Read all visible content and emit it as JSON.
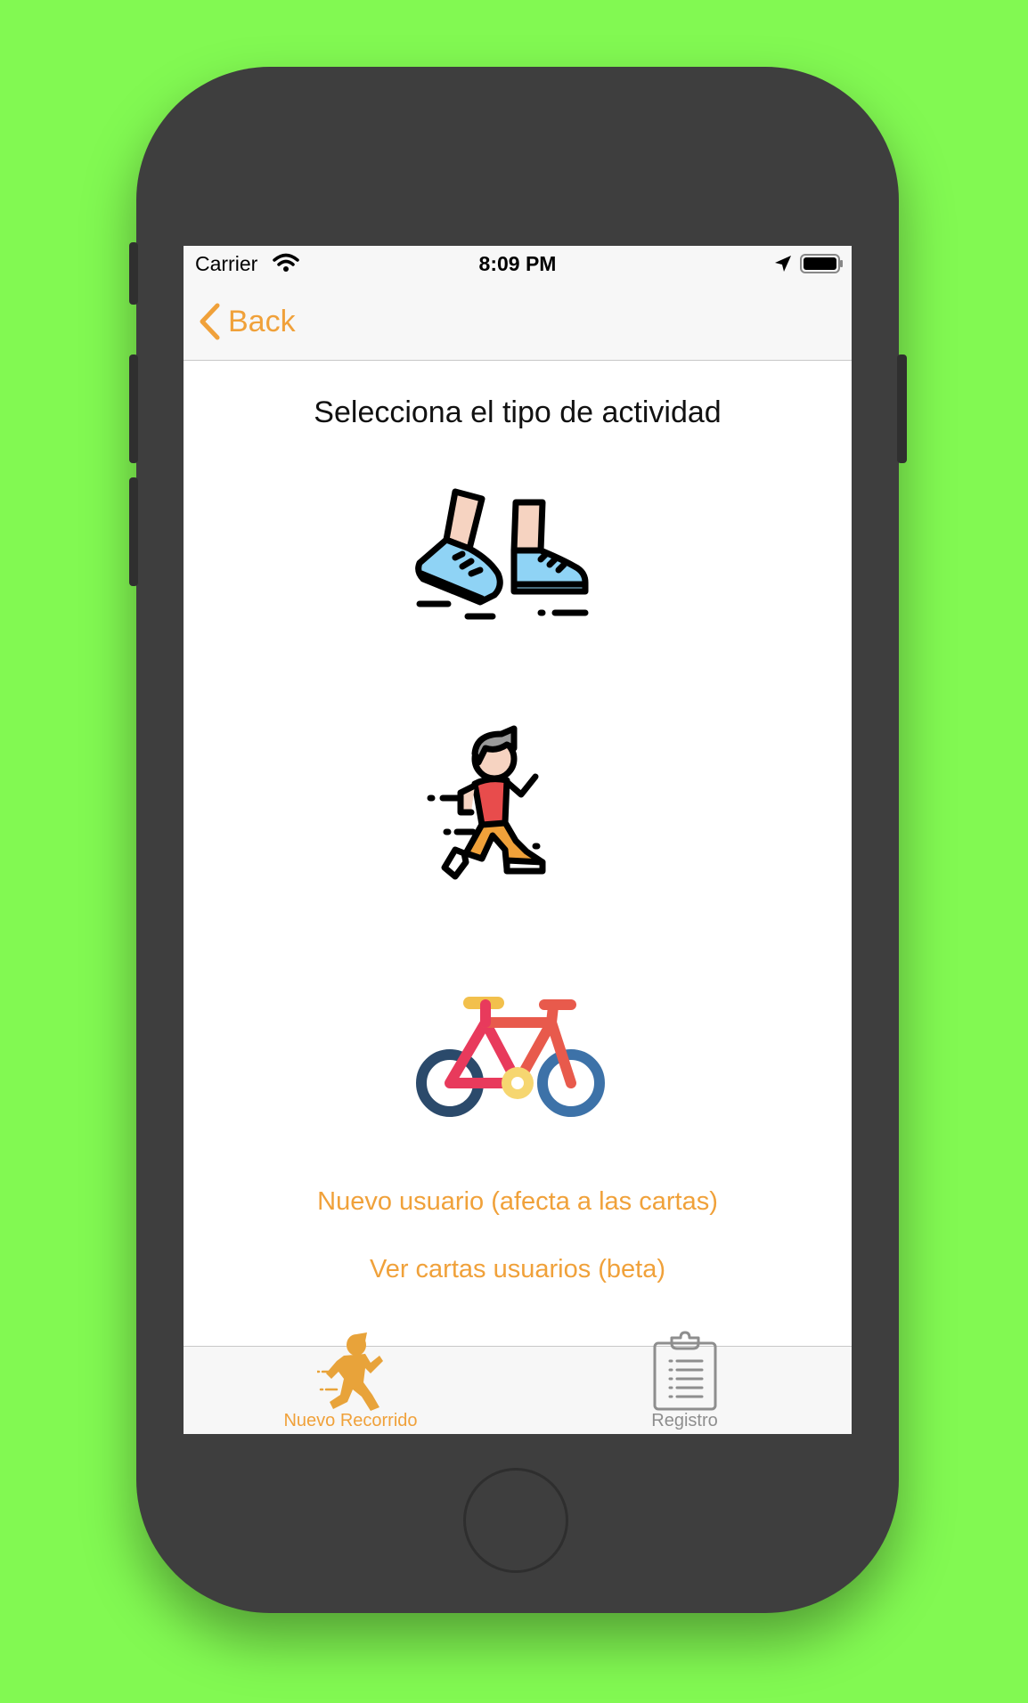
{
  "status_bar": {
    "carrier": "Carrier",
    "time": "8:09 PM"
  },
  "nav": {
    "back_label": "Back"
  },
  "main": {
    "heading": "Selecciona el tipo de actividad",
    "activities": [
      {
        "icon": "walking-shoes-icon"
      },
      {
        "icon": "running-man-icon"
      },
      {
        "icon": "bicycle-icon"
      }
    ],
    "new_user_link": "Nuevo usuario (afecta a las cartas)",
    "view_cards_link": "Ver cartas usuarios (beta)"
  },
  "tab_bar": {
    "tabs": [
      {
        "label": "Nuevo Recorrido",
        "icon": "running-figure-icon",
        "selected": true
      },
      {
        "label": "Registro",
        "icon": "clipboard-icon",
        "selected": false
      }
    ]
  },
  "colors": {
    "accent": "#f0a13a",
    "background": "#82f952",
    "device": "#3e3e3e",
    "inactive_tab": "#8e8e8e"
  }
}
